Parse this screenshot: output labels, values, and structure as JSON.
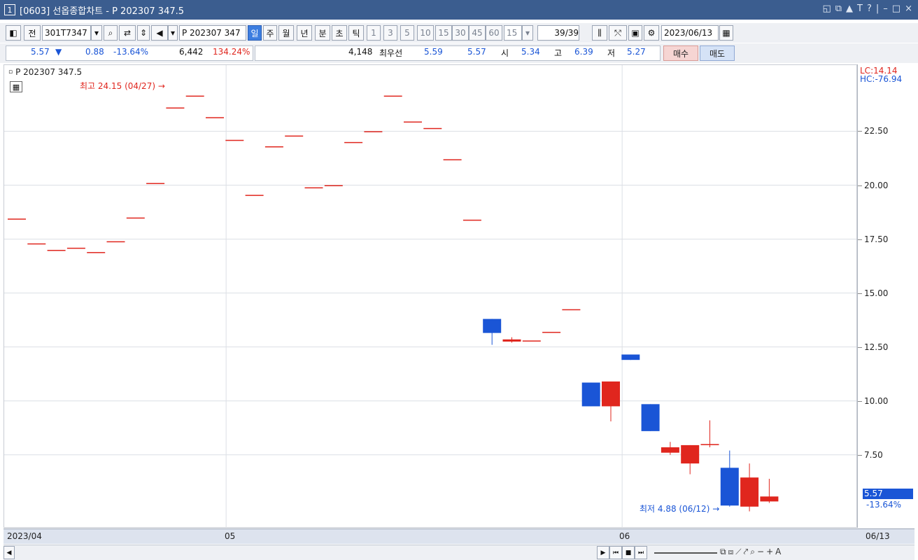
{
  "window": {
    "number": "1",
    "title": "[0603] 선옵종합차트 - P 202307 347.5"
  },
  "toolbar": {
    "prev_label": "전",
    "code_value": "301T7347",
    "symbol_value": "P 202307 347",
    "periods": [
      "일",
      "주",
      "월",
      "년",
      "분",
      "초",
      "틱"
    ],
    "selected_period": "일",
    "intervals": [
      "1",
      "3",
      "5",
      "10",
      "15",
      "30",
      "45",
      "60"
    ],
    "interval_value": "15",
    "count_value": "39",
    "count_total": "/39",
    "date_value": "2023/06/13"
  },
  "quote": {
    "price": "5.57",
    "direction_icon": "▼",
    "change": "0.88",
    "change_pct": "-13.64%",
    "volume": "6,442",
    "volume_pct": "134.24%",
    "bid_qty": "4,148",
    "best_label": "최우선",
    "best_ask": "5.59",
    "best_bid": "5.57",
    "open_label": "시",
    "open": "5.34",
    "high_label": "고",
    "high": "6.39",
    "low_label": "저",
    "low": "5.27",
    "buy_label": "매수",
    "sell_label": "매도"
  },
  "legend": {
    "series_name": "P 202307 347.5"
  },
  "axis_labels": {
    "lc": "LC:14.14",
    "hc": "HC:-76.94",
    "last_price": "5.57",
    "last_change": "-13.64%"
  },
  "annotations": {
    "high": "최고 24.15 (04/27)",
    "low": "최저 4.88 (06/12)"
  },
  "chart_data": {
    "type": "candlestick",
    "x_labels": [
      "2023/04",
      "05",
      "06",
      "06/13"
    ],
    "y_ticks": [
      "22.50",
      "20.00",
      "17.50",
      "15.00",
      "12.50",
      "10.00",
      "7.50"
    ],
    "ylim": [
      4.8,
      25.5
    ],
    "grid": true,
    "up_color": "#e0261e",
    "down_color": "#1a55d6",
    "candles": [
      {
        "o": 18.45,
        "h": 18.45,
        "l": 18.45,
        "c": 18.45
      },
      {
        "o": 17.3,
        "h": 17.3,
        "l": 17.3,
        "c": 17.3
      },
      {
        "o": 17.0,
        "h": 17.0,
        "l": 17.0,
        "c": 17.0
      },
      {
        "o": 17.1,
        "h": 17.1,
        "l": 17.1,
        "c": 17.1
      },
      {
        "o": 16.9,
        "h": 16.9,
        "l": 16.9,
        "c": 16.9
      },
      {
        "o": 17.4,
        "h": 17.4,
        "l": 17.4,
        "c": 17.4
      },
      {
        "o": 18.5,
        "h": 18.5,
        "l": 18.5,
        "c": 18.5
      },
      {
        "o": 20.1,
        "h": 20.1,
        "l": 20.1,
        "c": 20.1
      },
      {
        "o": 23.6,
        "h": 23.6,
        "l": 23.6,
        "c": 23.6
      },
      {
        "o": 24.15,
        "h": 24.15,
        "l": 24.15,
        "c": 24.15
      },
      {
        "o": 23.15,
        "h": 23.15,
        "l": 23.15,
        "c": 23.15
      },
      {
        "o": 22.1,
        "h": 22.1,
        "l": 22.1,
        "c": 22.1
      },
      {
        "o": 19.55,
        "h": 19.55,
        "l": 19.55,
        "c": 19.55
      },
      {
        "o": 21.8,
        "h": 21.8,
        "l": 21.8,
        "c": 21.8
      },
      {
        "o": 22.3,
        "h": 22.3,
        "l": 22.3,
        "c": 22.3
      },
      {
        "o": 19.9,
        "h": 19.9,
        "l": 19.9,
        "c": 19.9
      },
      {
        "o": 20.0,
        "h": 20.0,
        "l": 20.0,
        "c": 20.0
      },
      {
        "o": 22.0,
        "h": 22.0,
        "l": 22.0,
        "c": 22.0
      },
      {
        "o": 22.5,
        "h": 22.5,
        "l": 22.5,
        "c": 22.5
      },
      {
        "o": 24.15,
        "h": 24.15,
        "l": 24.15,
        "c": 24.15
      },
      {
        "o": 22.95,
        "h": 22.95,
        "l": 22.95,
        "c": 22.95
      },
      {
        "o": 22.65,
        "h": 22.65,
        "l": 22.65,
        "c": 22.65
      },
      {
        "o": 21.2,
        "h": 21.2,
        "l": 21.2,
        "c": 21.2
      },
      {
        "o": 18.4,
        "h": 18.4,
        "l": 18.4,
        "c": 18.4
      },
      {
        "o": 13.8,
        "h": 13.8,
        "l": 12.6,
        "c": 13.15
      },
      {
        "o": 12.75,
        "h": 12.95,
        "l": 12.7,
        "c": 12.85
      },
      {
        "o": 12.8,
        "h": 12.8,
        "l": 12.8,
        "c": 12.8
      },
      {
        "o": 13.2,
        "h": 13.2,
        "l": 13.2,
        "c": 13.2
      },
      {
        "o": 14.25,
        "h": 14.25,
        "l": 14.25,
        "c": 14.25
      },
      {
        "o": 10.85,
        "h": 10.85,
        "l": 9.75,
        "c": 9.75
      },
      {
        "o": 9.75,
        "h": 10.9,
        "l": 9.05,
        "c": 10.9
      },
      {
        "o": 12.15,
        "h": 12.15,
        "l": 11.9,
        "c": 11.9
      },
      {
        "o": 9.85,
        "h": 9.85,
        "l": 8.6,
        "c": 8.6
      },
      {
        "o": 7.6,
        "h": 8.1,
        "l": 7.5,
        "c": 7.85
      },
      {
        "o": 7.1,
        "h": 7.95,
        "l": 6.6,
        "c": 7.95
      },
      {
        "o": 7.95,
        "h": 9.1,
        "l": 7.85,
        "c": 8.0
      },
      {
        "o": 6.9,
        "h": 7.7,
        "l": 5.1,
        "c": 5.15
      },
      {
        "o": 5.1,
        "h": 7.1,
        "l": 4.88,
        "c": 6.45
      },
      {
        "o": 5.34,
        "h": 6.39,
        "l": 5.27,
        "c": 5.57
      }
    ]
  }
}
